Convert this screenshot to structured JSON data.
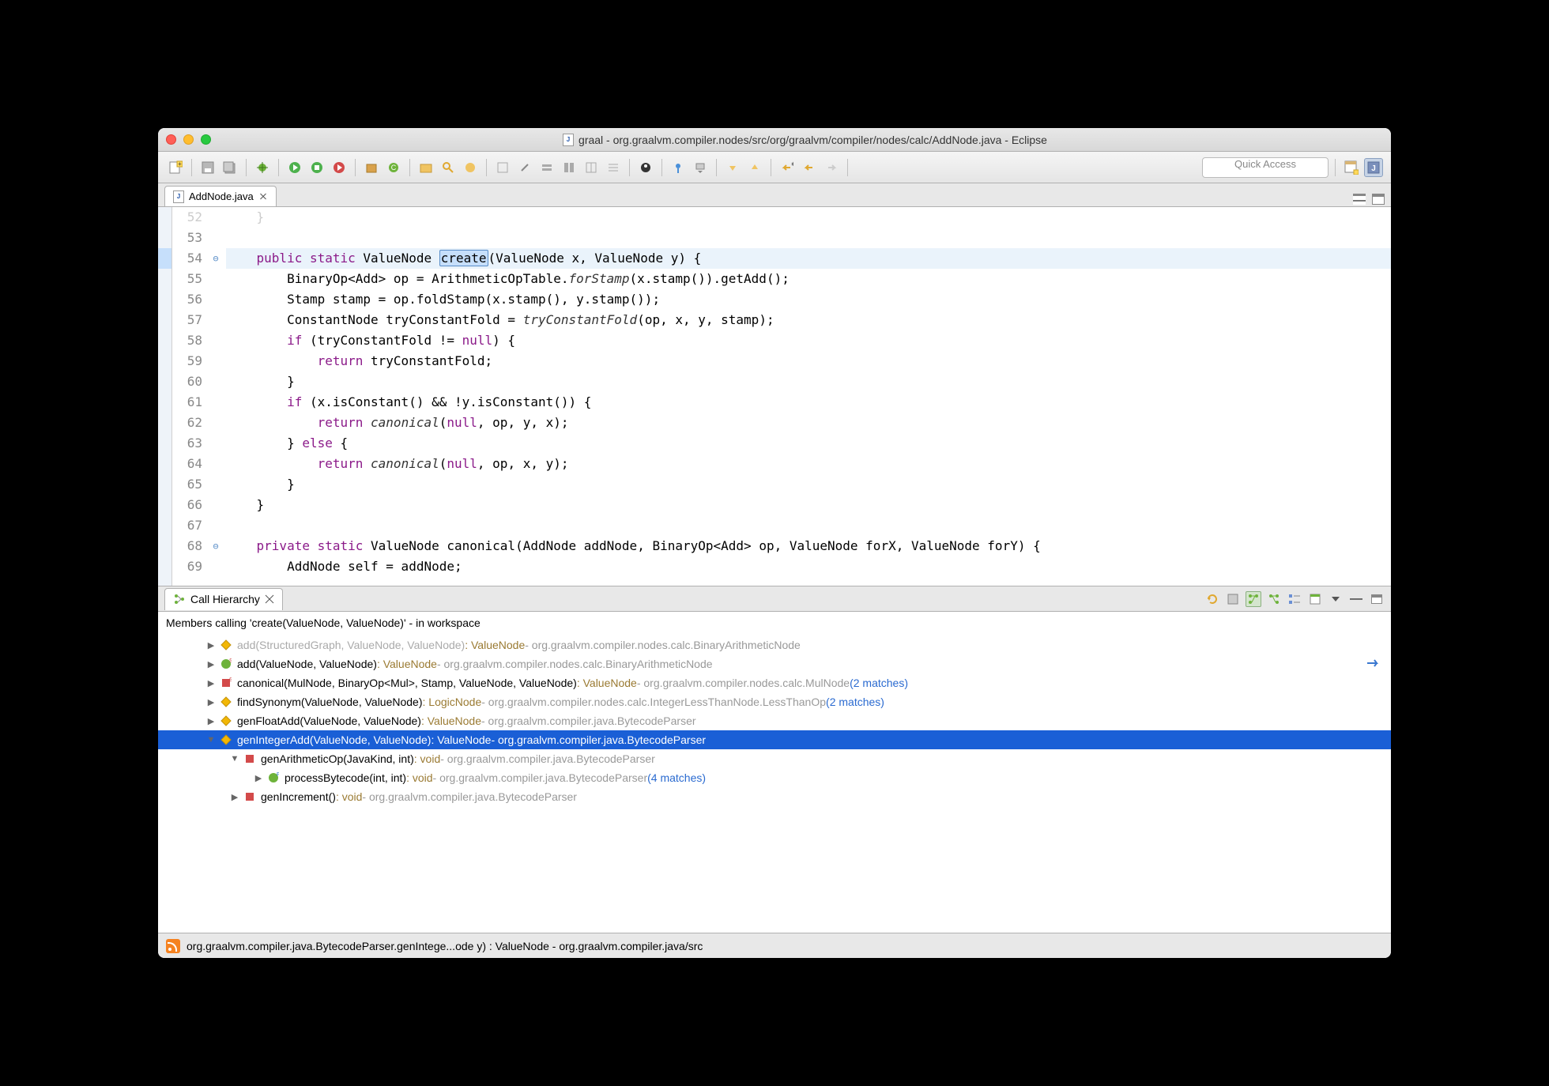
{
  "titlebar": {
    "title": "graal - org.graalvm.compiler.nodes/src/org/graalvm/compiler/nodes/calc/AddNode.java - Eclipse"
  },
  "toolbar": {
    "quick_access_placeholder": "Quick Access"
  },
  "editor_tab": {
    "label": "AddNode.java"
  },
  "code": {
    "lines": [
      {
        "num": "52",
        "text": "    }",
        "fold": "",
        "dim": true
      },
      {
        "num": "53",
        "text": ""
      },
      {
        "num": "54",
        "text_segments": [
          {
            "t": "    ",
            "c": ""
          },
          {
            "t": "public",
            "c": "kw"
          },
          {
            "t": " ",
            "c": ""
          },
          {
            "t": "static",
            "c": "kw"
          },
          {
            "t": " ValueNode ",
            "c": ""
          },
          {
            "t": "create",
            "c": "sel"
          },
          {
            "t": "(ValueNode x, ValueNode y) {",
            "c": ""
          }
        ],
        "fold": "⊖",
        "hl": true
      },
      {
        "num": "55",
        "text_segments": [
          {
            "t": "        BinaryOp<Add> op = ArithmeticOpTable.",
            "c": ""
          },
          {
            "t": "forStamp",
            "c": "ital"
          },
          {
            "t": "(x.stamp()).getAdd();",
            "c": ""
          }
        ]
      },
      {
        "num": "56",
        "text": "        Stamp stamp = op.foldStamp(x.stamp(), y.stamp());"
      },
      {
        "num": "57",
        "text_segments": [
          {
            "t": "        ConstantNode tryConstantFold = ",
            "c": ""
          },
          {
            "t": "tryConstantFold",
            "c": "ital"
          },
          {
            "t": "(op, x, y, stamp);",
            "c": ""
          }
        ]
      },
      {
        "num": "58",
        "text_segments": [
          {
            "t": "        ",
            "c": ""
          },
          {
            "t": "if",
            "c": "kw"
          },
          {
            "t": " (tryConstantFold != ",
            "c": ""
          },
          {
            "t": "null",
            "c": "kw"
          },
          {
            "t": ") {",
            "c": ""
          }
        ]
      },
      {
        "num": "59",
        "text_segments": [
          {
            "t": "            ",
            "c": ""
          },
          {
            "t": "return",
            "c": "kw"
          },
          {
            "t": " tryConstantFold;",
            "c": ""
          }
        ]
      },
      {
        "num": "60",
        "text": "        }"
      },
      {
        "num": "61",
        "text_segments": [
          {
            "t": "        ",
            "c": ""
          },
          {
            "t": "if",
            "c": "kw"
          },
          {
            "t": " (x.isConstant() && !y.isConstant()) {",
            "c": ""
          }
        ]
      },
      {
        "num": "62",
        "text_segments": [
          {
            "t": "            ",
            "c": ""
          },
          {
            "t": "return",
            "c": "kw"
          },
          {
            "t": " ",
            "c": ""
          },
          {
            "t": "canonical",
            "c": "ital"
          },
          {
            "t": "(",
            "c": ""
          },
          {
            "t": "null",
            "c": "kw"
          },
          {
            "t": ", op, y, x);",
            "c": ""
          }
        ]
      },
      {
        "num": "63",
        "text_segments": [
          {
            "t": "        } ",
            "c": ""
          },
          {
            "t": "else",
            "c": "kw"
          },
          {
            "t": " {",
            "c": ""
          }
        ]
      },
      {
        "num": "64",
        "text_segments": [
          {
            "t": "            ",
            "c": ""
          },
          {
            "t": "return",
            "c": "kw"
          },
          {
            "t": " ",
            "c": ""
          },
          {
            "t": "canonical",
            "c": "ital"
          },
          {
            "t": "(",
            "c": ""
          },
          {
            "t": "null",
            "c": "kw"
          },
          {
            "t": ", op, x, y);",
            "c": ""
          }
        ]
      },
      {
        "num": "65",
        "text": "        }"
      },
      {
        "num": "66",
        "text": "    }"
      },
      {
        "num": "67",
        "text": ""
      },
      {
        "num": "68",
        "text_segments": [
          {
            "t": "    ",
            "c": ""
          },
          {
            "t": "private",
            "c": "kw"
          },
          {
            "t": " ",
            "c": ""
          },
          {
            "t": "static",
            "c": "kw"
          },
          {
            "t": " ValueNode canonical(AddNode addNode, BinaryOp<Add> op, ValueNode forX, ValueNode forY) {",
            "c": ""
          }
        ],
        "fold": "⊖"
      },
      {
        "num": "69",
        "text": "        AddNode self = addNode;"
      }
    ]
  },
  "call_hierarchy": {
    "tab_label": "Call Hierarchy",
    "header": "Members calling 'create(ValueNode, ValueNode)' - in workspace",
    "rows": [
      {
        "indent": 1,
        "arrow": "▶",
        "icon": "diamond",
        "meth_dim": true,
        "meth": "add(StructuredGraph, ValueNode, ValueNode)",
        "ret": "ValueNode",
        "qual": "org.graalvm.compiler.nodes.calc.BinaryArithmeticNode",
        "match": ""
      },
      {
        "indent": 1,
        "arrow": "▶",
        "icon": "green-s",
        "meth": "add(ValueNode, ValueNode)",
        "ret": "ValueNode",
        "qual": "org.graalvm.compiler.nodes.calc.BinaryArithmeticNode",
        "match": ""
      },
      {
        "indent": 1,
        "arrow": "▶",
        "icon": "red-s",
        "meth": "canonical(MulNode, BinaryOp<Mul>, Stamp, ValueNode, ValueNode)",
        "ret": "ValueNode",
        "qual": "org.graalvm.compiler.nodes.calc.MulNode",
        "match": "(2 matches)"
      },
      {
        "indent": 1,
        "arrow": "▶",
        "icon": "diamond",
        "meth": "findSynonym(ValueNode, ValueNode)",
        "ret": "LogicNode",
        "qual": "org.graalvm.compiler.nodes.calc.IntegerLessThanNode.LessThanOp",
        "match": "(2 matches)"
      },
      {
        "indent": 1,
        "arrow": "▶",
        "icon": "diamond",
        "meth": "genFloatAdd(ValueNode, ValueNode)",
        "ret": "ValueNode",
        "qual": "org.graalvm.compiler.java.BytecodeParser",
        "match": ""
      },
      {
        "indent": 1,
        "arrow": "▼",
        "icon": "diamond",
        "meth": "genIntegerAdd(ValueNode, ValueNode)",
        "ret": "ValueNode",
        "qual": "org.graalvm.compiler.java.BytecodeParser",
        "match": "",
        "selected": true
      },
      {
        "indent": 2,
        "arrow": "▼",
        "icon": "red-sq",
        "meth": "genArithmeticOp(JavaKind, int)",
        "ret": "void",
        "qual": "org.graalvm.compiler.java.BytecodeParser",
        "match": ""
      },
      {
        "indent": 3,
        "arrow": "▶",
        "icon": "green-f",
        "meth": "processBytecode(int, int)",
        "ret": "void",
        "qual": "org.graalvm.compiler.java.BytecodeParser",
        "match": "(4 matches)"
      },
      {
        "indent": 2,
        "arrow": "▶",
        "icon": "red-sq",
        "meth": "genIncrement()",
        "ret": "void",
        "qual": "org.graalvm.compiler.java.BytecodeParser",
        "match": ""
      }
    ]
  },
  "status": {
    "text": "org.graalvm.compiler.java.BytecodeParser.genIntege...ode y) : ValueNode - org.graalvm.compiler.java/src"
  }
}
